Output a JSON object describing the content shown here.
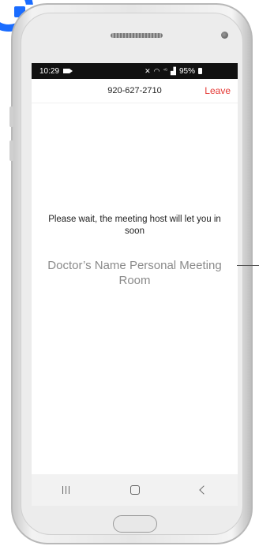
{
  "status_bar": {
    "time": "10:29",
    "signal_text": "⁴ᴳ",
    "battery": "95%"
  },
  "top_bar": {
    "meeting_id": "920-627-2710",
    "leave_label": "Leave"
  },
  "main": {
    "wait_message": "Please wait, the meeting host will let you in soon",
    "room_name": "Doctor’s Name Personal Meeting Room"
  },
  "colors": {
    "leave": "#e53935",
    "logo": "#1a6cff"
  },
  "icons": {
    "status": [
      "video-camera-icon",
      "mute-icon",
      "wifi-icon",
      "signal-icon",
      "battery-icon"
    ],
    "nav": [
      "recent-apps-icon",
      "home-icon",
      "back-icon"
    ]
  }
}
